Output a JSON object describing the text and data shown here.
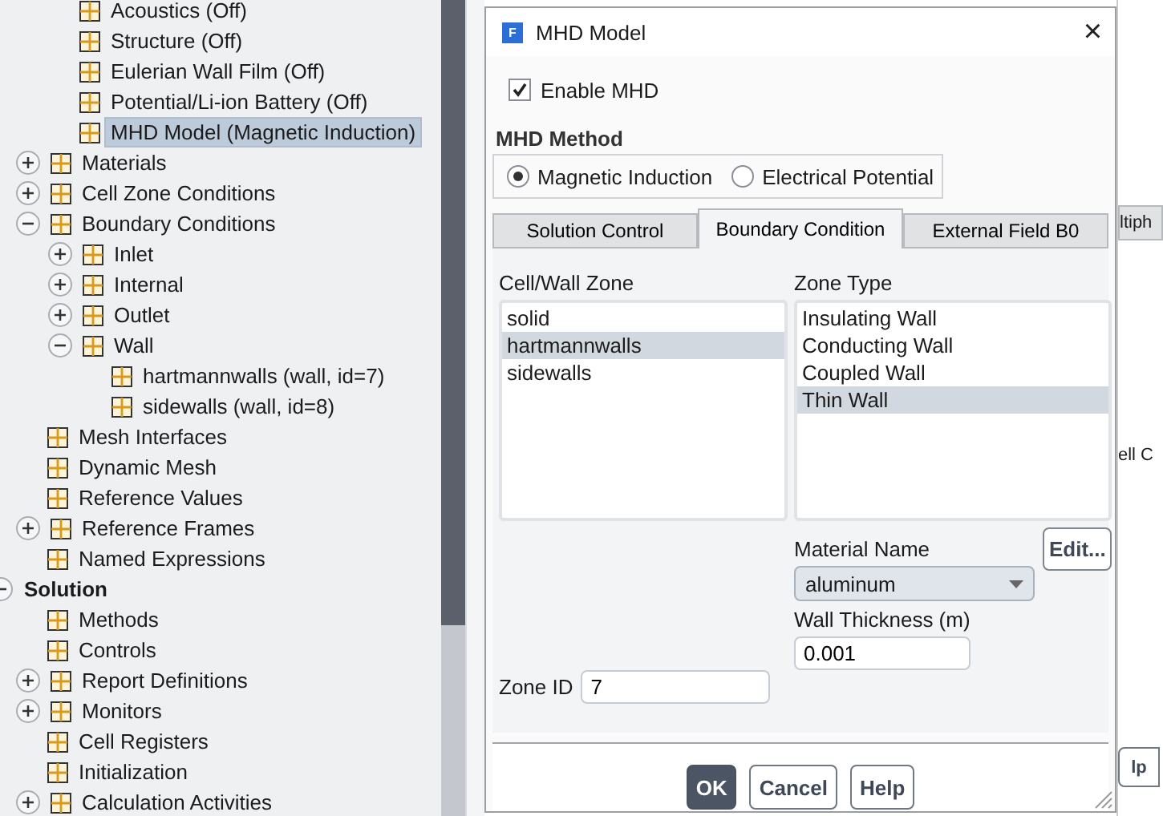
{
  "tree": [
    {
      "children": [
        {
          "children": [
            {
              "label": "Acoustics (Off)",
              "selected": false
            },
            {
              "label": "Structure (Off)",
              "selected": false
            },
            {
              "label": "Eulerian Wall Film (Off)",
              "selected": false
            },
            {
              "label": "Potential/Li-ion Battery (Off)",
              "selected": false
            },
            {
              "label": "MHD Model (Magnetic Induction)",
              "selected": true
            }
          ]
        },
        {
          "label": "Materials",
          "selected": false,
          "expanded": false
        },
        {
          "label": "Cell Zone Conditions",
          "selected": false,
          "expanded": false
        },
        {
          "label": "Boundary Conditions",
          "selected": false,
          "expanded": true,
          "children": [
            {
              "label": "Inlet",
              "selected": false,
              "expanded": false
            },
            {
              "label": "Internal",
              "selected": false,
              "expanded": false
            },
            {
              "label": "Outlet",
              "selected": false,
              "expanded": false
            },
            {
              "label": "Wall",
              "selected": false,
              "expanded": true,
              "children": [
                {
                  "label": "hartmannwalls (wall, id=7)",
                  "selected": false
                },
                {
                  "label": "sidewalls (wall, id=8)",
                  "selected": false
                }
              ]
            }
          ]
        },
        {
          "label": "Mesh Interfaces",
          "selected": false
        },
        {
          "label": "Dynamic Mesh",
          "selected": false
        },
        {
          "label": "Reference Values",
          "selected": false
        },
        {
          "label": "Reference Frames",
          "selected": false,
          "expanded": false
        },
        {
          "label": "Named Expressions",
          "selected": false
        }
      ]
    },
    {
      "label": "Solution",
      "selected": false,
      "expanded": true,
      "children": [
        {
          "label": "Methods",
          "selected": false
        },
        {
          "label": "Controls",
          "selected": false
        },
        {
          "label": "Report Definitions",
          "selected": false,
          "expanded": false
        },
        {
          "label": "Monitors",
          "selected": false,
          "expanded": false
        },
        {
          "label": "Cell Registers",
          "selected": false
        },
        {
          "label": "Initialization",
          "selected": false
        },
        {
          "label": "Calculation Activities",
          "selected": false,
          "expanded": false
        }
      ]
    }
  ],
  "dialog": {
    "title": "MHD Model",
    "logo": "F",
    "close": "×",
    "enable": {
      "label": "Enable MHD",
      "checked": true
    },
    "method": {
      "title": "MHD Method",
      "options": [
        {
          "label": "Magnetic Induction",
          "selected": true
        },
        {
          "label": "Electrical Potential",
          "selected": false
        }
      ]
    },
    "tabs": [
      {
        "label": "Solution Control",
        "selected": false
      },
      {
        "label": "Boundary Condition",
        "selected": true
      },
      {
        "label": "External Field B0",
        "selected": false
      }
    ],
    "zone_list": {
      "title": "Cell/Wall Zone",
      "items": [
        {
          "label": "solid",
          "selected": false
        },
        {
          "label": "hartmannwalls",
          "selected": true
        },
        {
          "label": "sidewalls",
          "selected": false
        }
      ]
    },
    "type_list": {
      "title": "Zone Type",
      "items": [
        {
          "label": "Insulating Wall",
          "selected": false
        },
        {
          "label": "Conducting Wall",
          "selected": false
        },
        {
          "label": "Coupled Wall",
          "selected": false
        },
        {
          "label": "Thin Wall",
          "selected": true
        }
      ]
    },
    "material": {
      "label": "Material Name",
      "value": "aluminum",
      "edit": "Edit..."
    },
    "thickness": {
      "label": "Wall Thickness (m)",
      "value": "0.001"
    },
    "zone_id": {
      "label": "Zone ID",
      "value": "7"
    },
    "buttons": [
      {
        "label": "OK",
        "primary": true
      },
      {
        "label": "Cancel",
        "primary": false
      },
      {
        "label": "Help",
        "primary": false
      }
    ]
  },
  "background": {
    "tab": "ltiph",
    "text": "ell C",
    "button": "lp"
  }
}
